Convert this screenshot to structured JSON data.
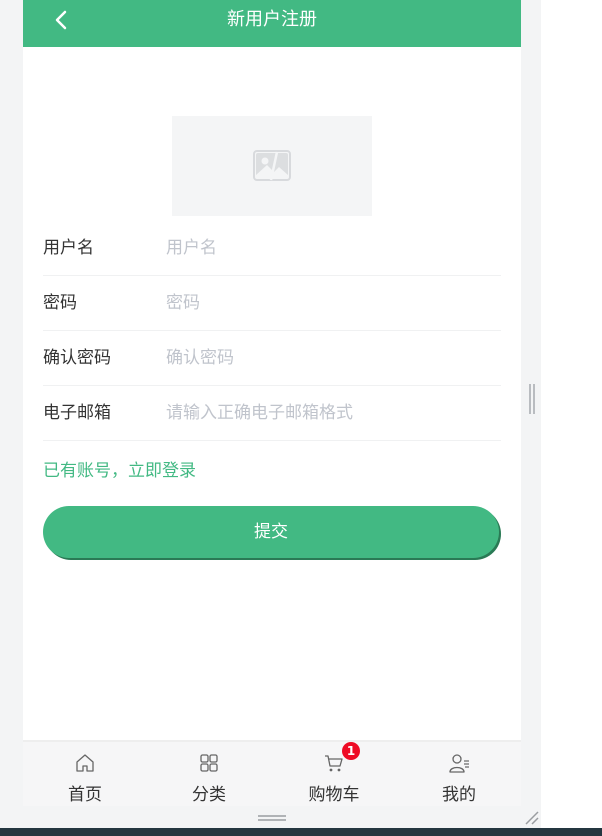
{
  "header": {
    "title": "新用户注册",
    "back_icon": "chevron-left-icon"
  },
  "avatar": {
    "icon": "image-placeholder-icon"
  },
  "form": {
    "fields": [
      {
        "label": "用户名",
        "placeholder": "用户名",
        "value": ""
      },
      {
        "label": "密码",
        "placeholder": "密码",
        "value": ""
      },
      {
        "label": "确认密码",
        "placeholder": "确认密码",
        "value": ""
      },
      {
        "label": "电子邮箱",
        "placeholder": "请输入正确电子邮箱格式",
        "value": ""
      }
    ],
    "login_link": "已有账号，立即登录",
    "submit_label": "提交"
  },
  "tabbar": {
    "items": [
      {
        "label": "首页",
        "icon": "home-icon"
      },
      {
        "label": "分类",
        "icon": "grid-icon"
      },
      {
        "label": "购物车",
        "icon": "cart-icon",
        "badge": "1"
      },
      {
        "label": "我的",
        "icon": "user-icon"
      }
    ]
  },
  "colors": {
    "brand": "#42b983",
    "badge": "#ee0a24"
  }
}
